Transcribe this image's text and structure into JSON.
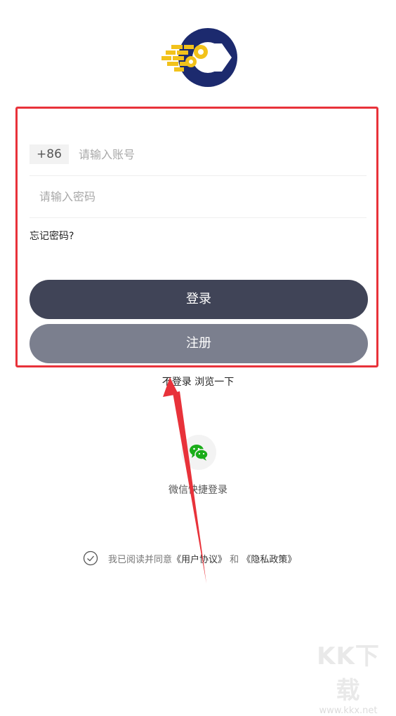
{
  "login_form": {
    "country_code": "+86",
    "account_placeholder": "请输入账号",
    "password_placeholder": "请输入密码",
    "forgot_password": "忘记密码?",
    "login_button": "登录",
    "register_button": "注册"
  },
  "browse_link": "不登录 浏览一下",
  "wechat": {
    "label": "微信快捷登录",
    "icon": "wechat-icon"
  },
  "agreement": {
    "prefix": "我已阅读并同意",
    "user_agreement": "《用户协议》",
    "conjunction": "和",
    "privacy_policy": "《隐私政策》",
    "checked": false
  },
  "watermark": {
    "logo": "KK下载",
    "url": "www.kkx.net"
  },
  "colors": {
    "login_button": "#404457",
    "register_button": "#7b7f8e",
    "highlight_border": "#e8323a",
    "arrow": "#e8323a",
    "wechat_green": "#1aad19",
    "logo_navy": "#1c2a6e",
    "logo_yellow": "#f2c21b"
  }
}
